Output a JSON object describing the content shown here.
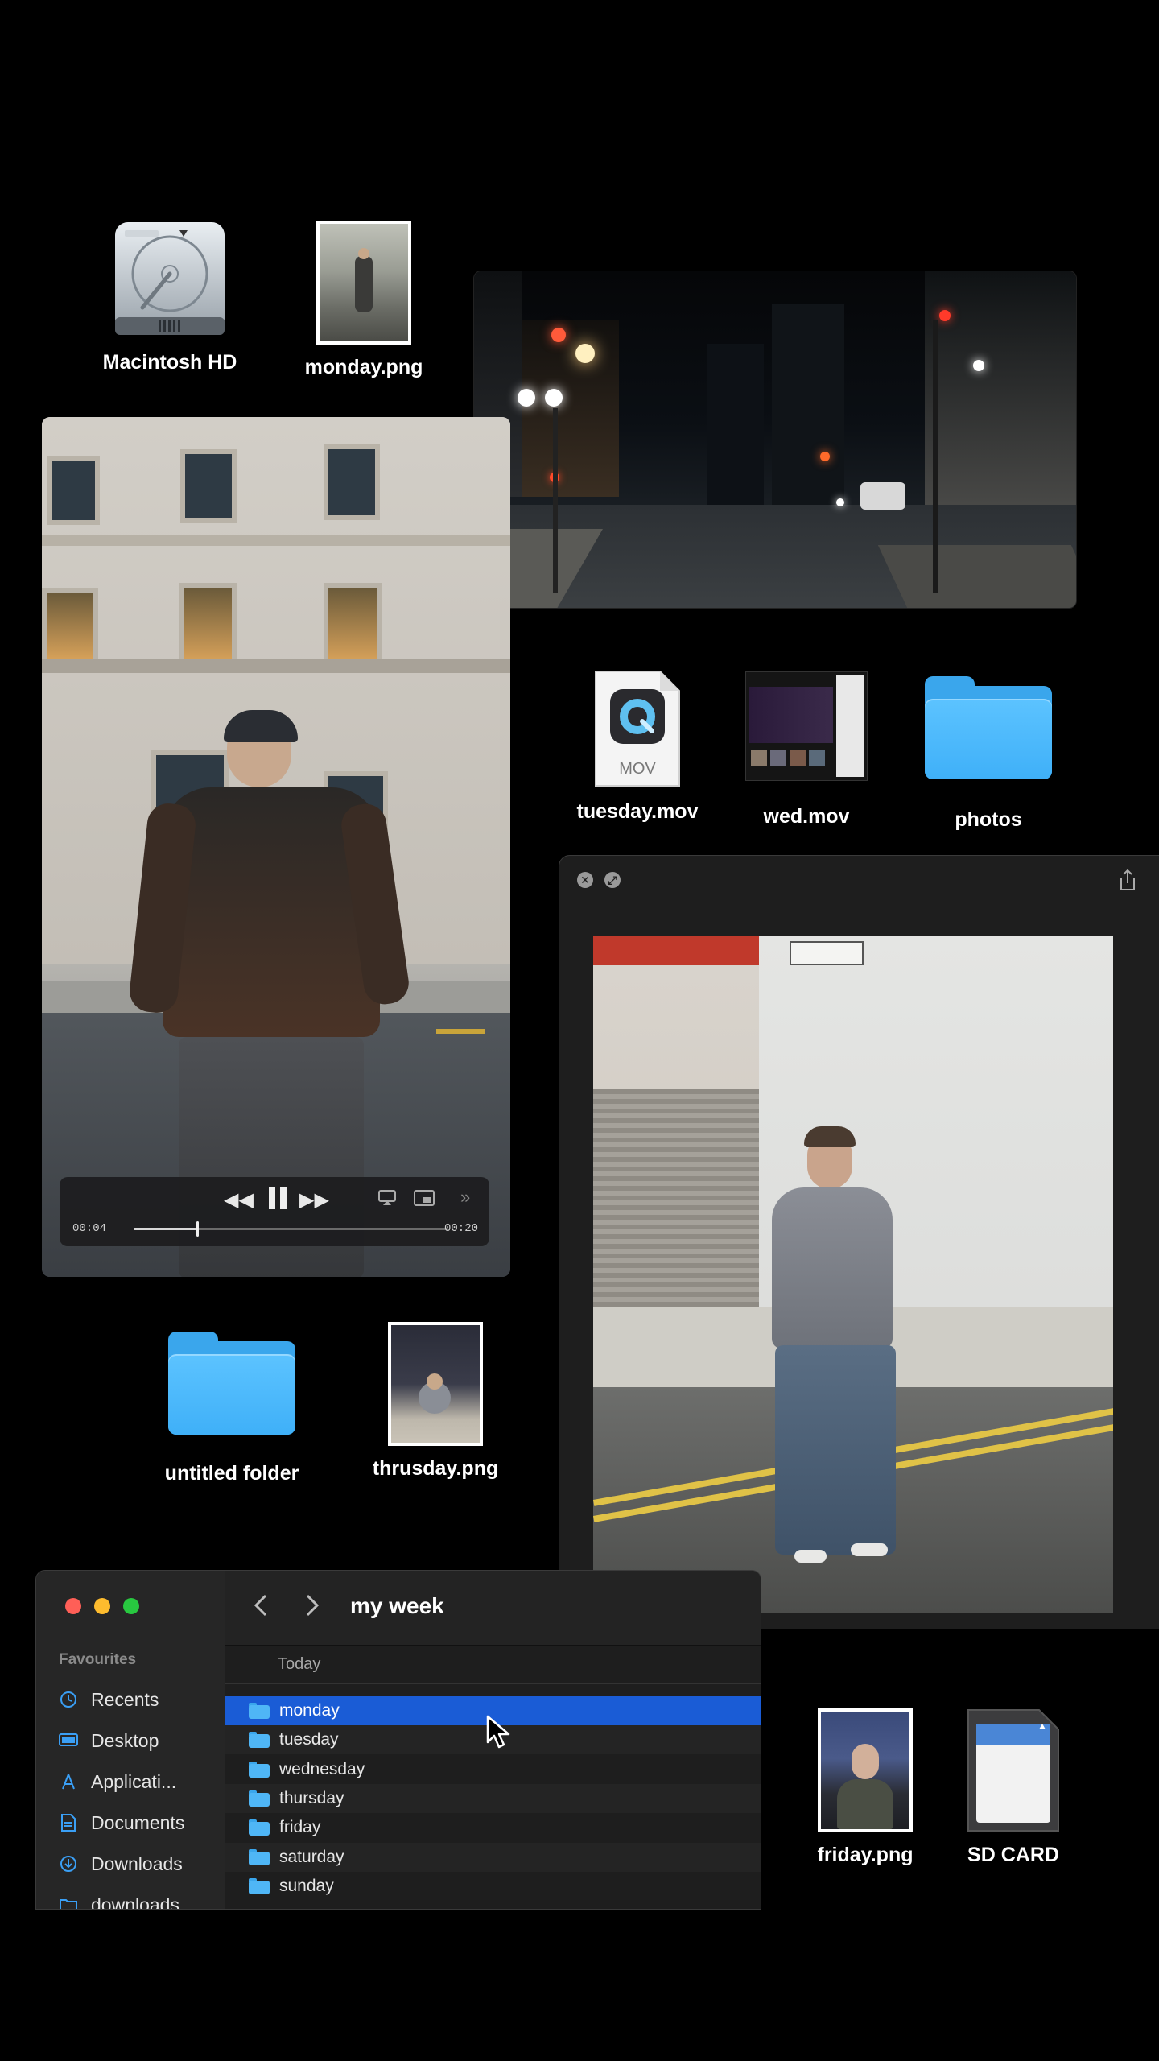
{
  "desktop_icons": {
    "macintosh_hd": "Macintosh HD",
    "monday_png": "monday.png",
    "tuesday_mov": "tuesday.mov",
    "tuesday_mov_badge": "MOV",
    "wed_mov": "wed.mov",
    "photos": "photos",
    "untitled_folder": "untitled folder",
    "thrusday_png": "thrusday.png",
    "friday_png": "friday.png",
    "sd_card": "SD CARD"
  },
  "video_player": {
    "current_time": "00:04",
    "duration": "00:20",
    "progress": 0.2
  },
  "quicklook": {
    "close_label": "✕",
    "fullscreen_label": "⤢"
  },
  "finder": {
    "title": "my week",
    "sidebar": {
      "heading": "Favourites",
      "items": [
        {
          "label": "Recents",
          "icon": "clock-icon"
        },
        {
          "label": "Desktop",
          "icon": "desktop-icon"
        },
        {
          "label": "Applicati...",
          "icon": "applications-icon"
        },
        {
          "label": "Documents",
          "icon": "document-icon"
        },
        {
          "label": "Downloads",
          "icon": "download-icon"
        },
        {
          "label": "downloads",
          "icon": "folder-icon"
        }
      ]
    },
    "group_header": "Today",
    "files": [
      "monday",
      "tuesday",
      "wednesday",
      "thursday",
      "friday",
      "saturday",
      "sunday"
    ],
    "selected": "monday"
  },
  "colors": {
    "accent": "#1a5cd6",
    "folder": "#4fb6f6",
    "close": "#ff5f57",
    "minimize": "#febc2e",
    "zoom": "#28c840"
  }
}
